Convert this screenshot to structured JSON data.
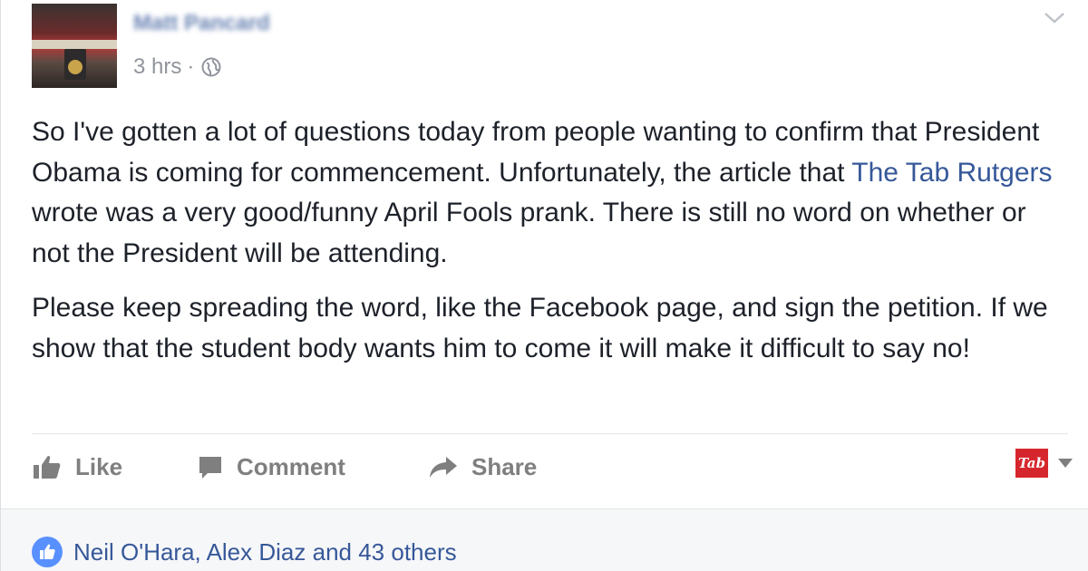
{
  "post": {
    "author": "Matt Pancard",
    "time": "3 hrs",
    "separator": "·",
    "privacy_icon": "globe-icon",
    "body": {
      "p1_before": "So I've gotten a lot of questions today from people wanting to confirm that President Obama is coming for commencement. Unfortunately, the article that ",
      "p1_link": "The Tab Rutgers",
      "p1_after": " wrote was a very good/funny April Fools prank. There is still no word on whether or not the President will be attending.",
      "p2": "Please keep spreading the word, like the Facebook page, and sign the petition. If we show that the student body wants him to come it will make it difficult to say no!"
    }
  },
  "actions": {
    "like": "Like",
    "comment": "Comment",
    "share": "Share"
  },
  "page_switcher": {
    "logo_text": "Tab"
  },
  "reactions": {
    "text": "Neil O'Hara, Alex Diaz and 43 others"
  },
  "colors": {
    "link": "#365899",
    "text": "#1d2129",
    "meta": "#90949c",
    "action": "#7f7f7f",
    "like_badge": "#5890ff",
    "tab_brand": "#d6262d"
  }
}
